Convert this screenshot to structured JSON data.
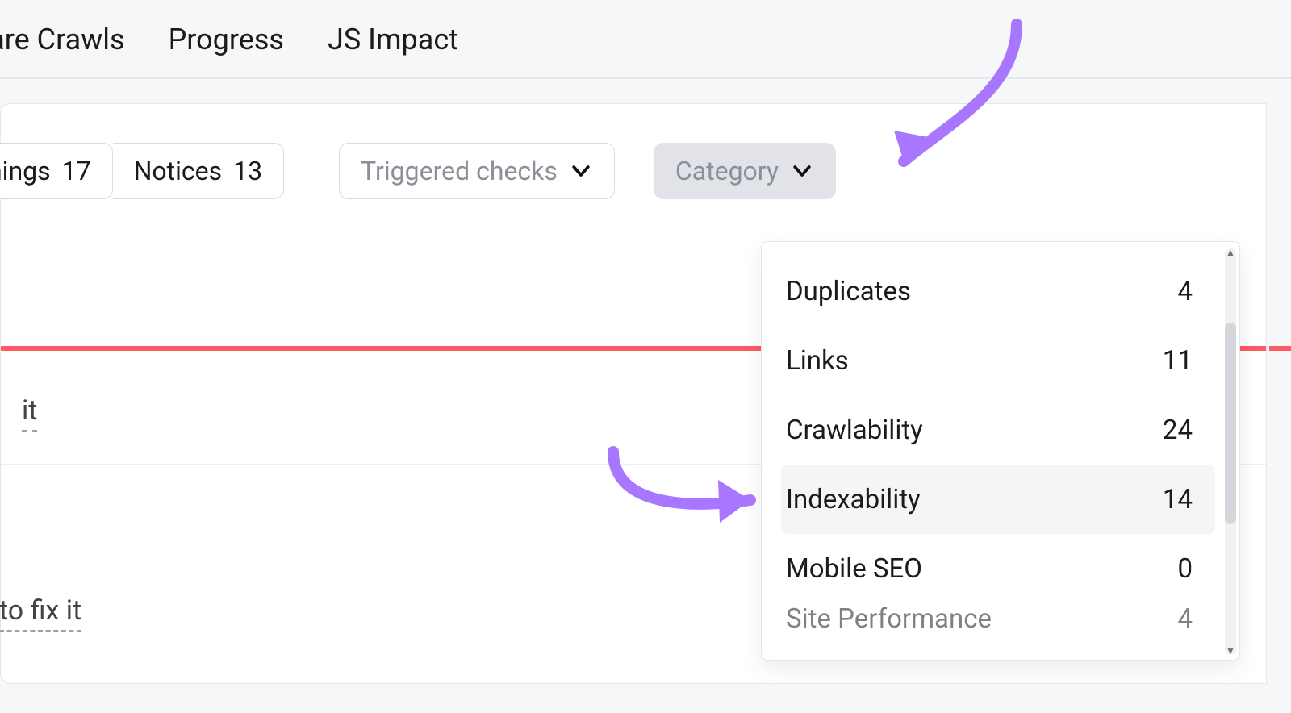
{
  "tabs": {
    "compare_crawls": "pare Crawls",
    "progress": "Progress",
    "js_impact": "JS Impact"
  },
  "filters": {
    "warnings_label": "nings",
    "warnings_count": "17",
    "notices_label": "Notices",
    "notices_count": "13",
    "triggered_label": "Triggered checks",
    "category_label": "Category"
  },
  "dropdown": {
    "items": [
      {
        "label": "Duplicates",
        "count": "4"
      },
      {
        "label": "Links",
        "count": "11"
      },
      {
        "label": "Crawlability",
        "count": "24"
      },
      {
        "label": "Indexability",
        "count": "14"
      },
      {
        "label": "Mobile SEO",
        "count": "0"
      }
    ],
    "peek_label": "Site Performance",
    "peek_count": "4",
    "highlight_index": 3
  },
  "hints": {
    "fix1": "it",
    "fix2": "to fix it"
  }
}
